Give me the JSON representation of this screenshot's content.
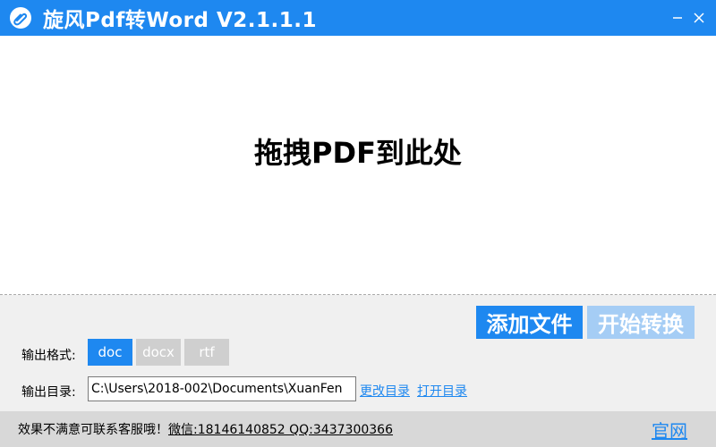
{
  "app": {
    "title": "旋风Pdf转Word   V2.1.1.1",
    "logo_icon": "paperclip-logo-icon",
    "minimize_icon": "minimize-icon",
    "close_icon": "close-icon"
  },
  "dropzone": {
    "text": "拖拽PDF到此处"
  },
  "actions": {
    "add_file": "添加文件",
    "start_convert": "开始转换"
  },
  "output_format": {
    "label": "输出格式:",
    "options": [
      "doc",
      "docx",
      "rtf"
    ],
    "selected": "doc"
  },
  "output_dir": {
    "label": "输出目录:",
    "path": "C:\\Users\\2018-002\\Documents\\XuanFen",
    "change_link": "更改目录",
    "open_link": "打开目录"
  },
  "footer": {
    "text": "效果不满意可联系客服哦！",
    "contact": "微信:18146140852 QQ:3437300366",
    "official_link": "官网"
  },
  "colors": {
    "accent": "#1e88f0",
    "accent_light": "#a5cdf5",
    "inactive": "#cfcfcf",
    "panel": "#f0f0f0",
    "footer": "#d8d8d8"
  }
}
